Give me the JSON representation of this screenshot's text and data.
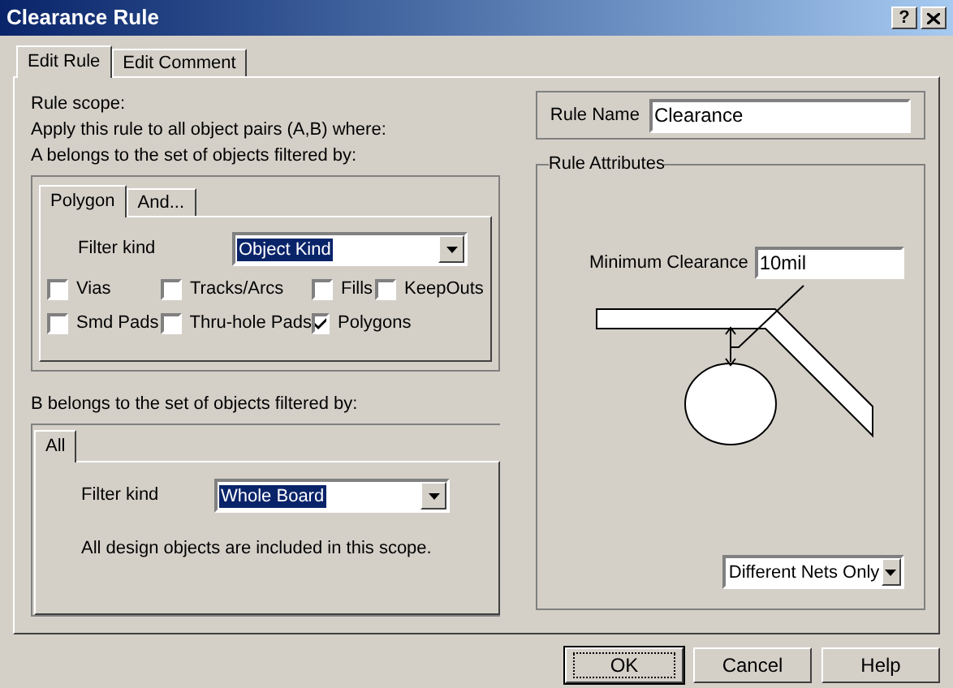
{
  "window": {
    "title": "Clearance Rule",
    "help_glyph": "?"
  },
  "tabs": [
    {
      "label": "Edit Rule",
      "selected": true
    },
    {
      "label": "Edit Comment",
      "selected": false
    }
  ],
  "scope": {
    "lines": [
      "Rule scope:",
      "Apply this rule to all object pairs (A,B) where:",
      "A belongs to the set of objects filtered by:"
    ]
  },
  "filter_a": {
    "tabs": [
      {
        "label": "Polygon",
        "selected": true
      },
      {
        "label": "And...",
        "selected": false
      }
    ],
    "filter_label": "Filter kind",
    "filter_value": "Object Kind",
    "checkboxes": [
      {
        "label": "Vias",
        "checked": false
      },
      {
        "label": "Tracks/Arcs",
        "checked": false
      },
      {
        "label": "Fills",
        "checked": false
      },
      {
        "label": "KeepOuts",
        "checked": false
      },
      {
        "label": "Smd Pads",
        "checked": false
      },
      {
        "label": "Thru-hole Pads",
        "checked": false
      },
      {
        "label": "Polygons",
        "checked": true
      }
    ]
  },
  "filter_b": {
    "heading": "B belongs to the set of objects filtered by:",
    "tabs": [
      {
        "label": "All",
        "selected": true
      }
    ],
    "filter_label": "Filter kind",
    "filter_value": "Whole Board",
    "note": "All design objects are included in this scope."
  },
  "rule_name": {
    "label": "Rule Name",
    "value": "Clearance"
  },
  "rule_attributes": {
    "title": "Rule Attributes",
    "min_clearance_label": "Minimum Clearance",
    "min_clearance_value": "10mil",
    "net_scope": "Different Nets Only"
  },
  "buttons": [
    {
      "label": "OK",
      "default": true
    },
    {
      "label": "Cancel",
      "default": false
    },
    {
      "label": "Help",
      "default": false
    }
  ]
}
